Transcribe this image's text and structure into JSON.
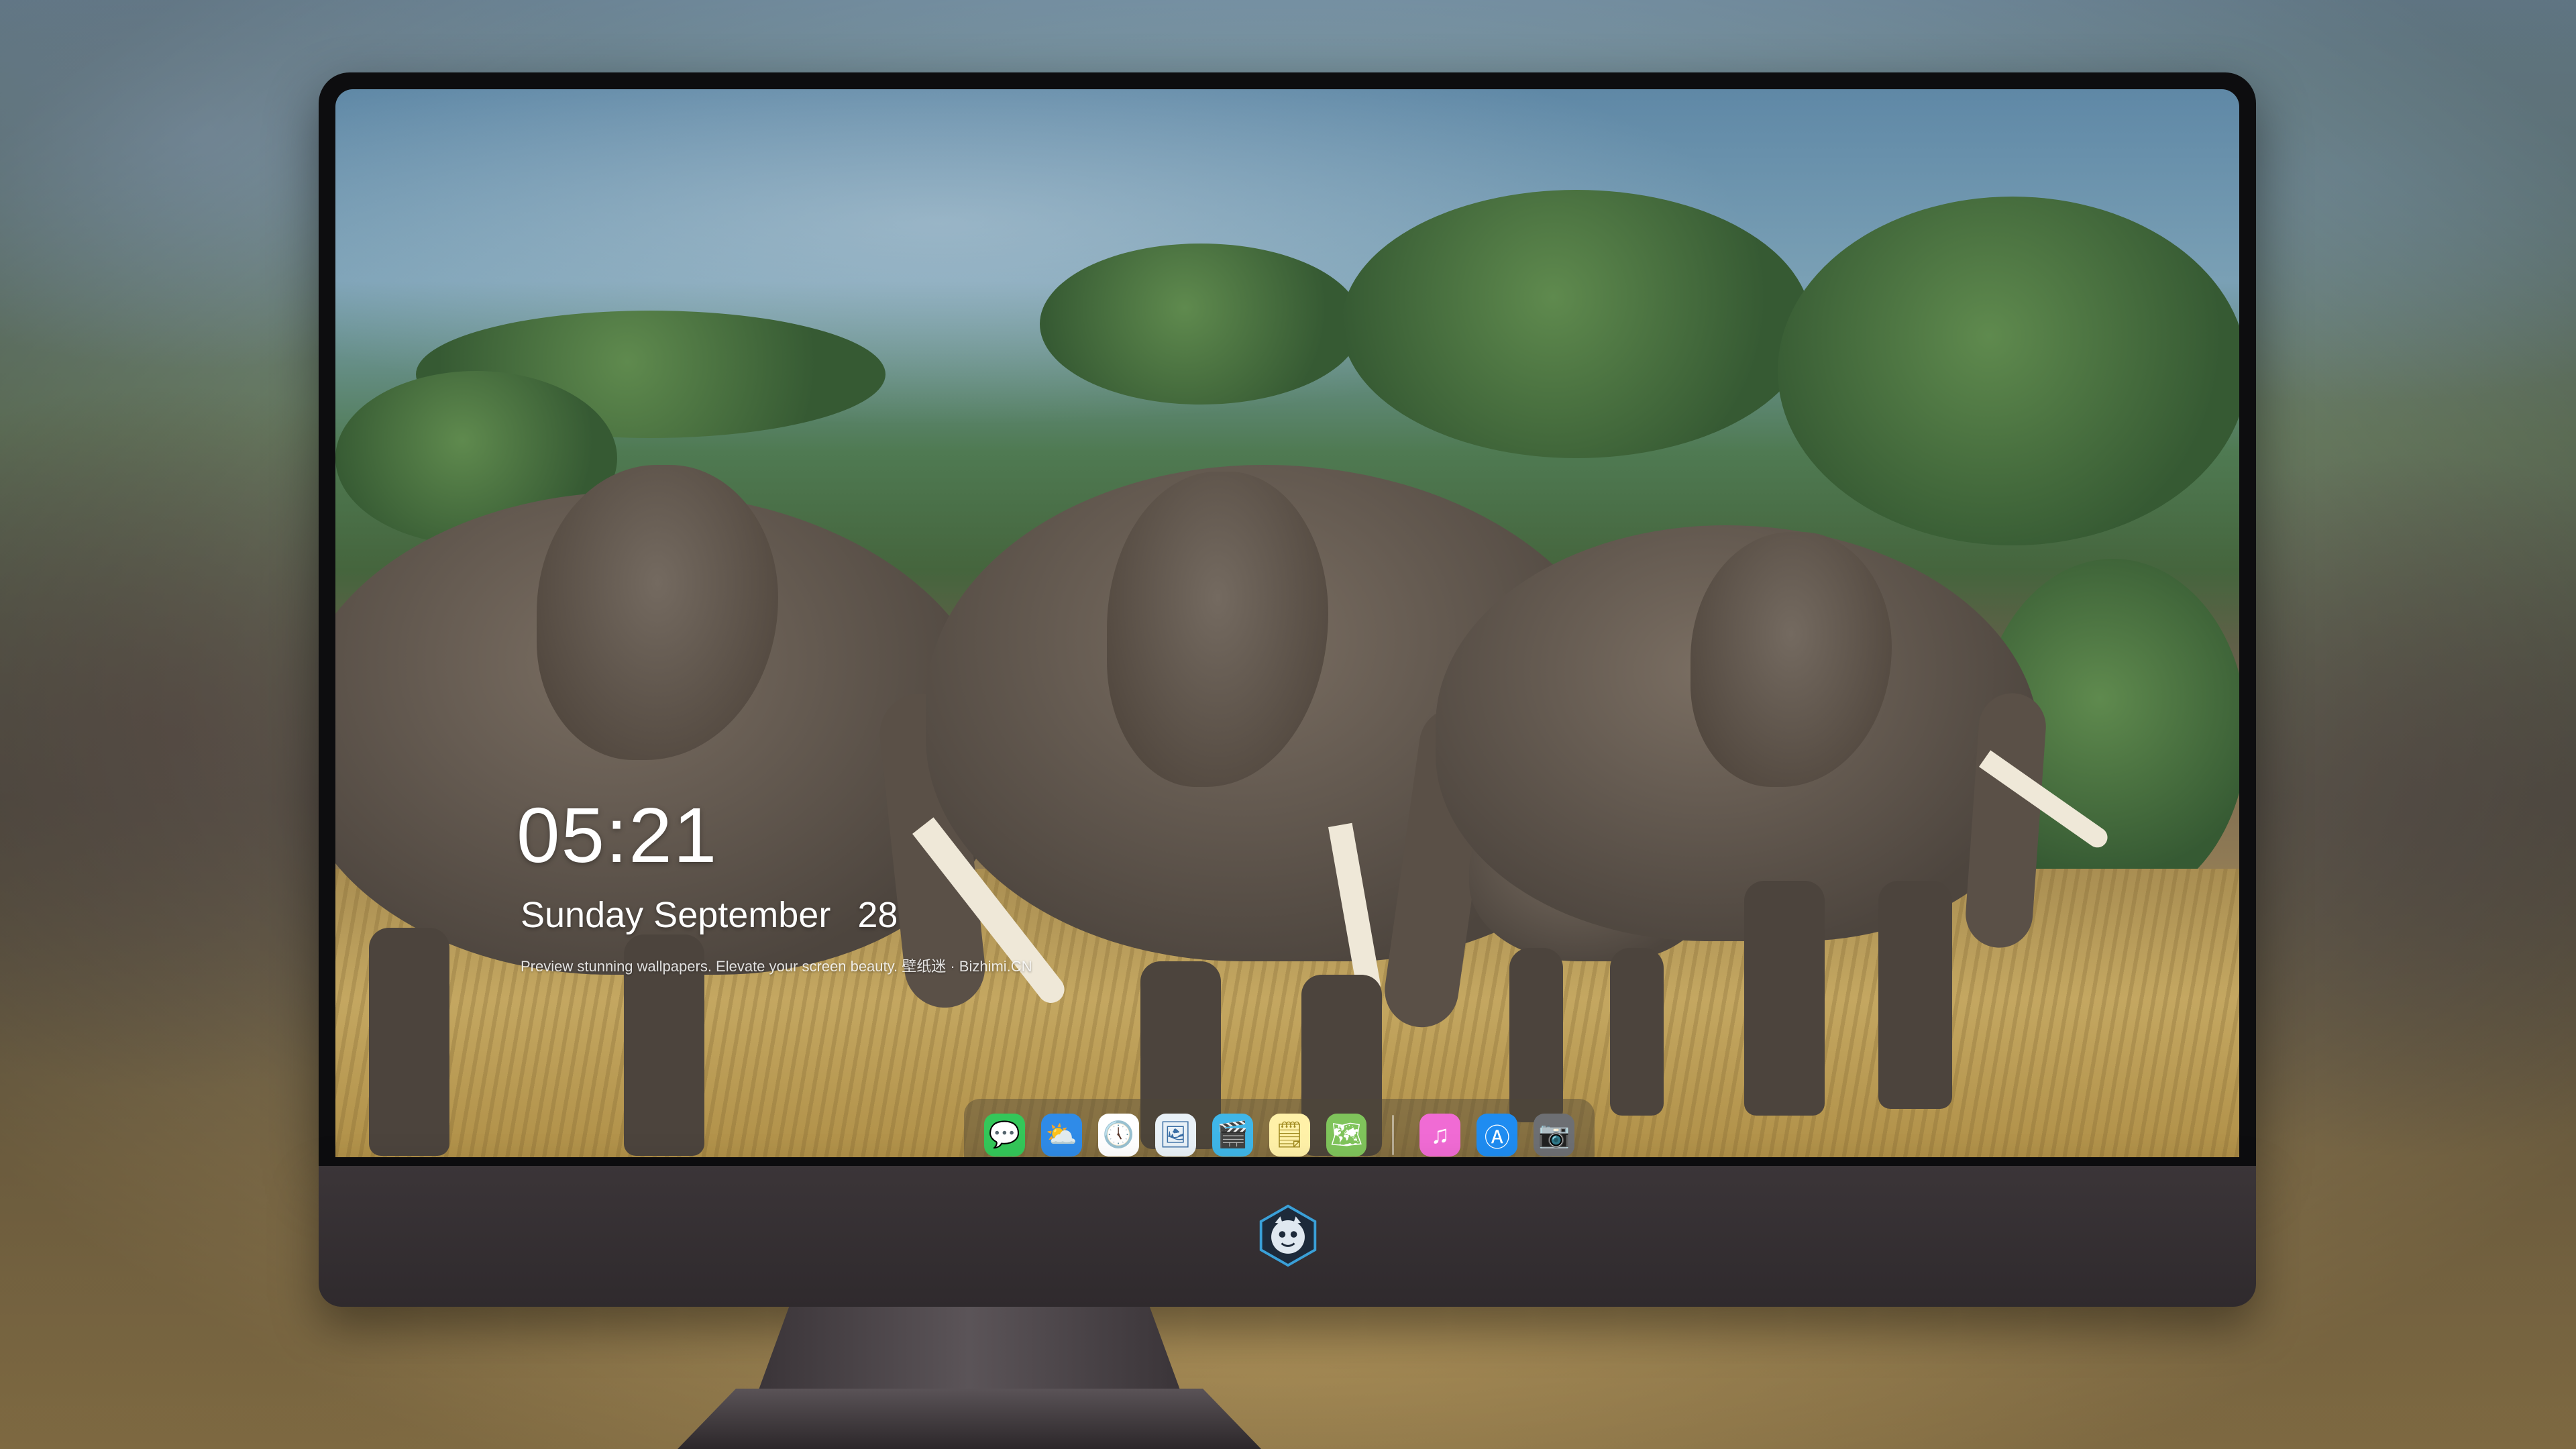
{
  "lockscreen": {
    "time": "05:21",
    "weekday": "Sunday",
    "month": "September",
    "day": "28",
    "tagline": "Preview stunning wallpapers. Elevate your screen beauty. 壁纸迷 · Bizhimi.CN"
  },
  "dock": {
    "items": [
      {
        "name": "messages-icon",
        "glyph": "💬",
        "color": "#34c759"
      },
      {
        "name": "weather-icon",
        "glyph": "⛅",
        "color": "#2f8be8"
      },
      {
        "name": "clock-icon",
        "glyph": "🕔",
        "color": "#ffffff"
      },
      {
        "name": "preview-icon",
        "glyph": "🖼",
        "color": "#e9f1f7"
      },
      {
        "name": "clips-icon",
        "glyph": "🎬",
        "color": "#3fb6e8"
      },
      {
        "name": "notes-icon",
        "glyph": "🗒",
        "color": "#fff1a8"
      },
      {
        "name": "maps-icon",
        "glyph": "🗺",
        "color": "#7fc45b"
      },
      {
        "name": "music-icon",
        "glyph": "♫",
        "color": "#f06bd4"
      },
      {
        "name": "app-store-icon",
        "glyph": "Ⓐ",
        "color": "#1e8cf1"
      },
      {
        "name": "camera-icon",
        "glyph": "📷",
        "color": "#6d6f73"
      }
    ]
  },
  "colors": {
    "chin": "#2f2a2d",
    "bezel": "#0d0d0f",
    "logo_accent": "#3aa0d8"
  }
}
